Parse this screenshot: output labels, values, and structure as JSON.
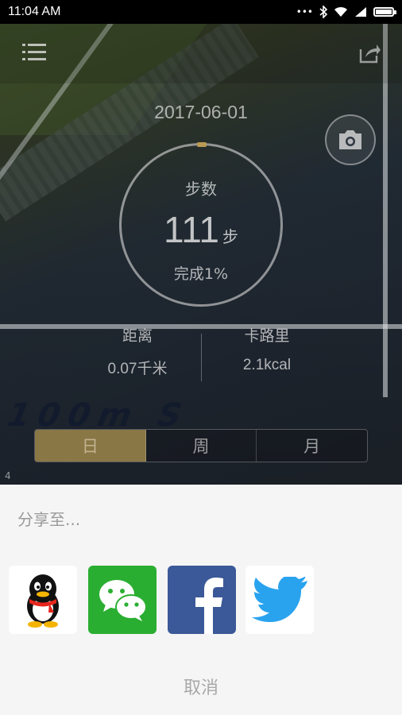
{
  "status_bar": {
    "time": "11:04 AM"
  },
  "main": {
    "date": "2017-06-01",
    "steps": {
      "label": "步数",
      "value": "111",
      "unit": "步",
      "completion": "完成1%"
    },
    "distance": {
      "label": "距离",
      "value": "0.07千米"
    },
    "calories": {
      "label": "卡路里",
      "value": "2.1kcal"
    },
    "period_tabs": [
      "日",
      "周",
      "月"
    ],
    "selected_tab": "日",
    "page_indicator": "4",
    "lane_text": "100m S"
  },
  "share_sheet": {
    "title": "分享至...",
    "cancel_label": "取消",
    "targets": [
      "qq-icon",
      "wechat-icon",
      "facebook-icon",
      "twitter-icon"
    ]
  },
  "colors": {
    "active_tab": "#8a7746",
    "wechat": "#2aae32",
    "facebook": "#3b5998",
    "twitter": "#1da1f2"
  }
}
